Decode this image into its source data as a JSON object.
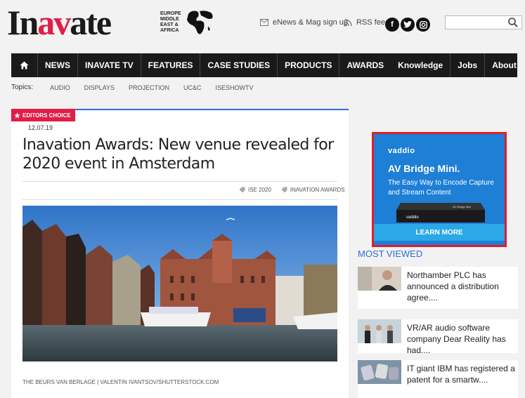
{
  "header": {
    "logo_prefix": "In",
    "logo_accent": "av",
    "logo_suffix": "ate",
    "region": "EUROPE MIDDLE EAST & AFRICA",
    "enews_label": "eNews & Mag sign up",
    "rss_label": "RSS feed",
    "social": [
      "f",
      "t",
      "ig"
    ],
    "search": {
      "placeholder": "",
      "value": ""
    }
  },
  "nav": {
    "items": [
      "NEWS",
      "INAVATE TV",
      "FEATURES",
      "CASE STUDIES",
      "PRODUCTS",
      "AWARDS",
      "Knowledge",
      "Jobs",
      "About"
    ]
  },
  "topics": {
    "label": "Topics:",
    "items": [
      "AUDIO",
      "DISPLAYS",
      "PROJECTION",
      "UC&C",
      "ISESHOWTV"
    ]
  },
  "article": {
    "badge": "EDITORS CHOICE",
    "date": "12.07.19",
    "title": "Inavation Awards: New venue revealed for 2020 event in Amsterdam",
    "tags": [
      "ISE 2020",
      "INAVATION AWARDS"
    ],
    "caption": "THE BEURS VAN BERLAGE | VALENTIN IVANTSOV/SHUTTERSTOCK.COM"
  },
  "ad": {
    "brand": "vaddio",
    "headline": "AV Bridge Mini.",
    "sub": "The Easy Way to Encode Capture and Stream Content",
    "device_brand": "vaddio",
    "device_label": "AV Bridge Mini",
    "cta": "LEARN MORE",
    "colors": {
      "border": "#e11d2a",
      "bg": "#1e7fd6",
      "cta": "#2aa8e8"
    }
  },
  "most_viewed": {
    "heading": "MOST VIEWED",
    "items": [
      {
        "text": "Northamber PLC has announced a distribution agree...."
      },
      {
        "text": "VR/AR audio software company Dear Reality has had...."
      },
      {
        "text": "IT giant IBM has registered a patent for a smartw...."
      }
    ]
  },
  "colors": {
    "accent": "#e11d48",
    "nav_bg": "#1a1a1a",
    "link_blue": "#2d6fd4"
  }
}
